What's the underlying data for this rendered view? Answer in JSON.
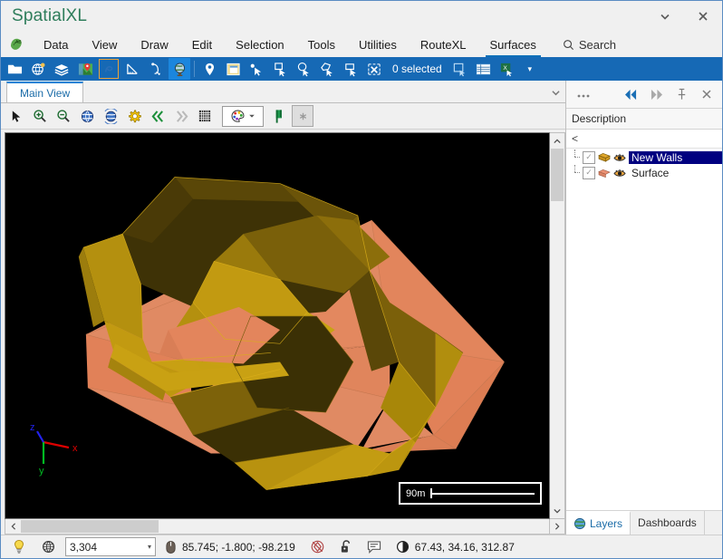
{
  "window": {
    "title": "SpatialXL",
    "minimize_label": "▾",
    "close_label": "✕"
  },
  "menubar": {
    "logo_name": "app-logo-icon",
    "items": [
      {
        "label": "Data",
        "active": false
      },
      {
        "label": "View",
        "active": false
      },
      {
        "label": "Draw",
        "active": false
      },
      {
        "label": "Edit",
        "active": false
      },
      {
        "label": "Selection",
        "active": false
      },
      {
        "label": "Tools",
        "active": false
      },
      {
        "label": "Utilities",
        "active": false
      },
      {
        "label": "RouteXL",
        "active": false
      },
      {
        "label": "Surfaces",
        "active": true
      }
    ],
    "search_label": "Search",
    "search_icon": "search-icon"
  },
  "ribbon": {
    "icons": [
      "open-folder-icon",
      "globe-palette-icon",
      "layers-stack-icon",
      "map-pin-image-icon",
      "boundary-tool-icon",
      "measure-triangle-icon",
      "node-edit-icon",
      "globe-view-icon",
      "location-pin-icon",
      "window-layout-icon",
      "select-point-icon",
      "select-rect-icon",
      "select-circle-icon",
      "select-polygon-icon",
      "select-box-icon",
      "clear-selection-icon"
    ],
    "selection_status": "0 selected",
    "trailing_icons": [
      "copy-selection-icon",
      "attribute-table-icon",
      "export-excel-icon"
    ],
    "overflow_label": "▾"
  },
  "document_tabs": {
    "tabs": [
      {
        "label": "Main View",
        "active": true
      }
    ],
    "collapse_label": "▾"
  },
  "view_toolbar": {
    "icons": [
      "pointer-arrow-icon",
      "zoom-in-icon",
      "zoom-out-icon",
      "zoom-extents-globe-icon",
      "zoom-selection-globe-icon",
      "settings-gear-icon",
      "previous-view-icon",
      "next-view-icon",
      "grid-icon"
    ],
    "palette_icon": "color-palette-icon",
    "palette_caret": "▾",
    "flag_icon": "green-flag-icon",
    "star_icon": "star-icon"
  },
  "viewport": {
    "background_color": "#000000",
    "axis": {
      "x_label": "x",
      "y_label": "y",
      "z_label": "z",
      "x_color": "#dd0000",
      "y_color": "#00bb22",
      "z_color": "#2222ee"
    },
    "scalebar": {
      "label": "90m"
    },
    "model": {
      "wall_color": "#b8910f",
      "wall_shadow_color": "#4a3a06",
      "surface_color": "#e3855e",
      "surface_shadow_color": "#c96a47"
    }
  },
  "scrollbars": {
    "vertical_up": "˄",
    "vertical_down": "˅",
    "horizontal_left": "˂",
    "horizontal_right": "˃"
  },
  "dock_panel": {
    "header_buttons": [
      {
        "name": "more-options-icon",
        "label": "⋯",
        "active": false
      },
      {
        "name": "collapse-left-icon",
        "label": "◀◀",
        "active": true
      },
      {
        "name": "expand-right-icon",
        "label": "▶▶",
        "active": false
      },
      {
        "name": "pin-icon",
        "label": "⚲",
        "active": false
      },
      {
        "name": "close-panel-icon",
        "label": "✕",
        "active": false
      }
    ],
    "tree_column_header": "Description",
    "filter_placeholder": "<",
    "tree_rows": [
      {
        "label": "New Walls",
        "checked": true,
        "selected": true,
        "swatch_color": "#e0a72c",
        "visibility_icon": "eye-icon"
      },
      {
        "label": "Surface",
        "checked": true,
        "selected": false,
        "swatch_color": "#eb9275",
        "visibility_icon": "eye-icon"
      }
    ],
    "bottom_tabs": [
      {
        "label": "Layers",
        "active": true,
        "icon": "globe-icon"
      },
      {
        "label": "Dashboards",
        "active": false,
        "icon": ""
      }
    ]
  },
  "statusbar": {
    "lightbulb_icon": "lightbulb-icon",
    "globe_icon": "wireframe-globe-icon",
    "scale_value": "3,304",
    "scale_caret": "▾",
    "mouse_icon": "mouse-icon",
    "coordinates": "85.745; -1.800; -98.219",
    "snap_icon": "snap-icon",
    "lock_icon": "unlocked-padlock-icon",
    "notes_icon": "annotation-icon",
    "view_icon": "view-angle-icon",
    "view_values": "67.43, 34.16, 312.87"
  }
}
